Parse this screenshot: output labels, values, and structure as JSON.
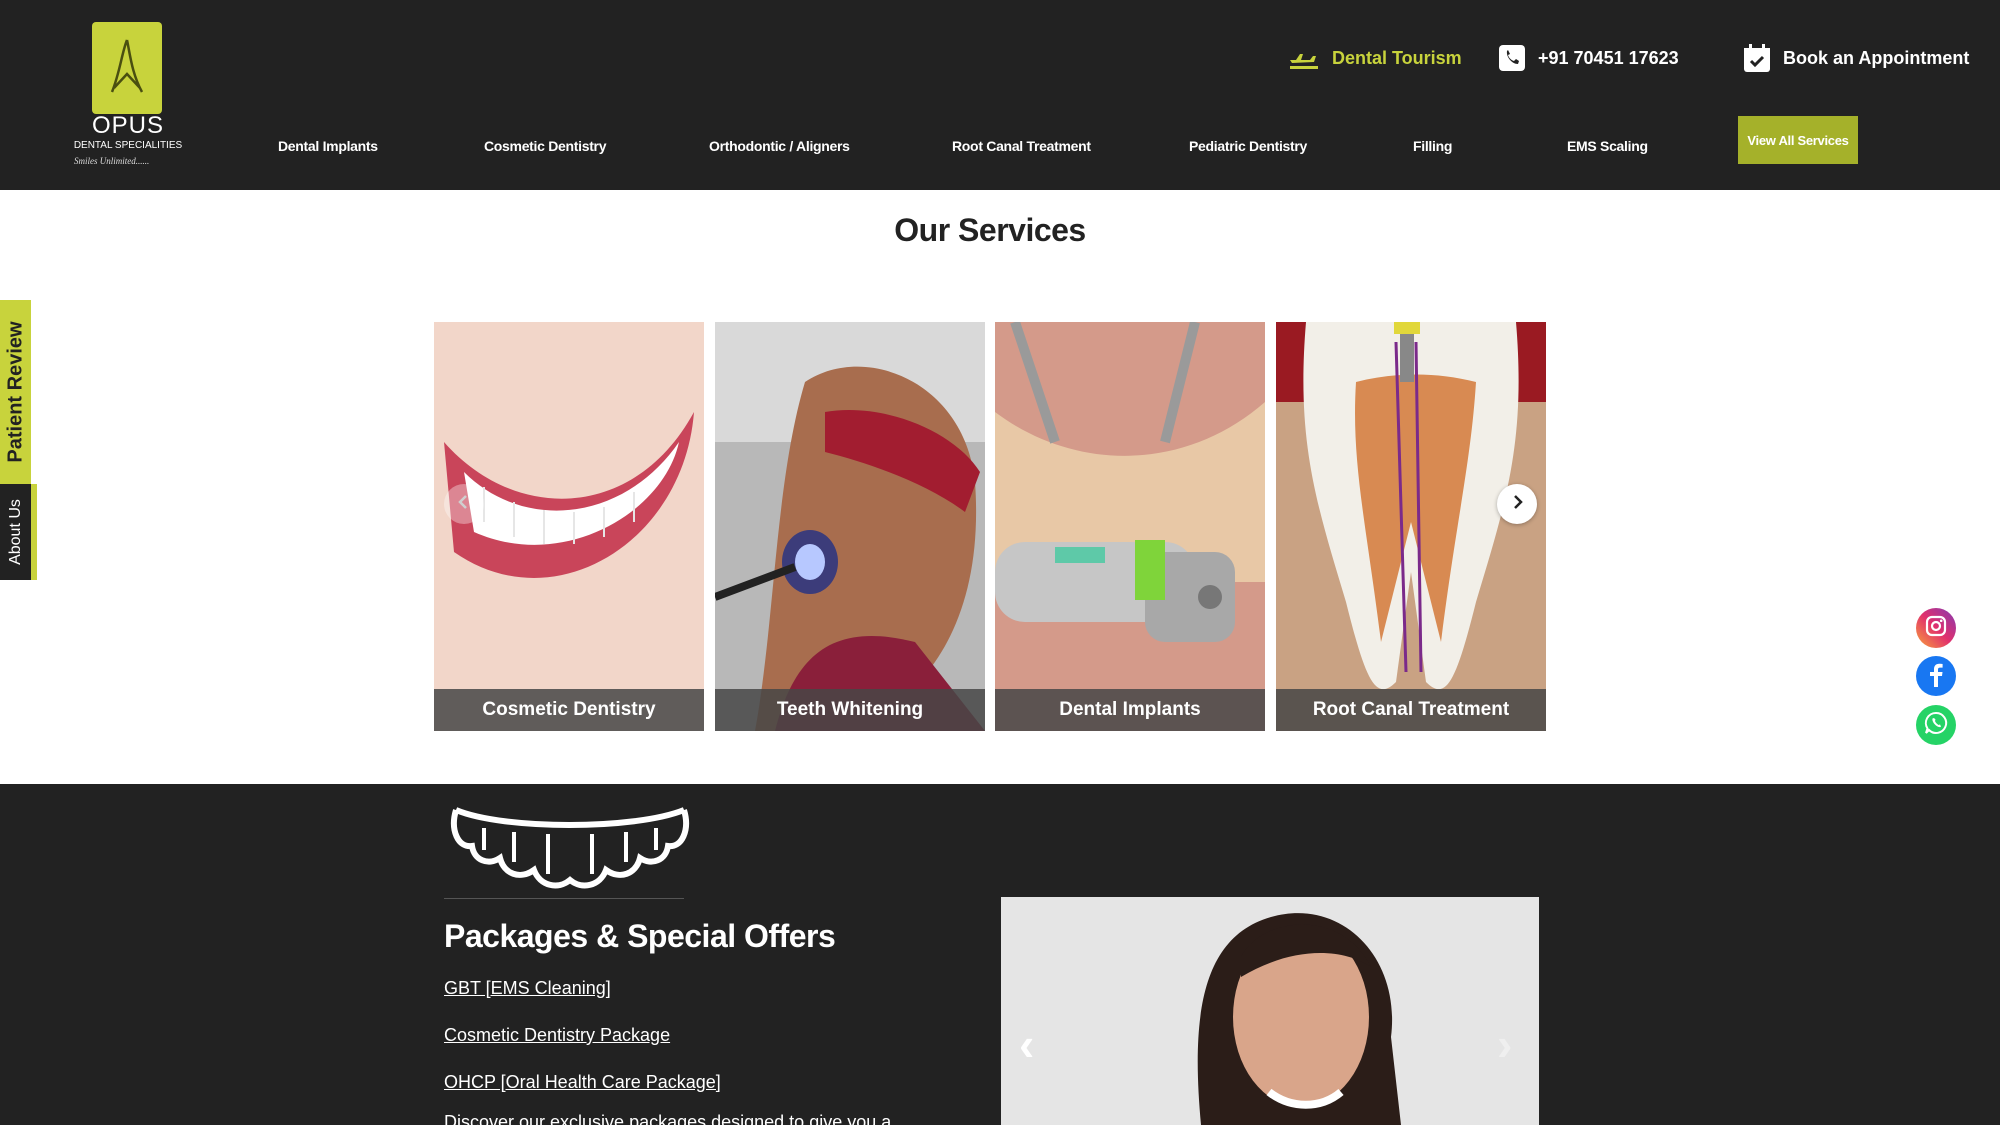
{
  "header": {
    "logo": {
      "name": "OPUS",
      "subtitle": "DENTAL SPECIALITIES",
      "tagline": "Smiles Unlimited......"
    },
    "top_links": {
      "tourism": "Dental Tourism",
      "phone": "+91 70451 17623",
      "appointment": "Book an Appointment"
    },
    "nav": [
      "Dental Implants",
      "Cosmetic Dentistry",
      "Orthodontic / Aligners",
      "Root Canal Treatment",
      "Pediatric Dentistry",
      "Filling",
      "EMS Scaling"
    ],
    "view_all": "View All Services"
  },
  "side_tabs": {
    "review": "Patient Review",
    "about": "About Us"
  },
  "services": {
    "title": "Our Services",
    "cards": [
      {
        "label": "Cosmetic Dentistry"
      },
      {
        "label": "Teeth Whitening"
      },
      {
        "label": "Dental Implants"
      },
      {
        "label": "Root Canal Treatment"
      }
    ]
  },
  "social": [
    "instagram-icon",
    "facebook-icon",
    "whatsapp-icon"
  ],
  "packages": {
    "title": "Packages & Special Offers",
    "links": [
      "GBT [EMS Cleaning]",
      "Cosmetic Dentistry Package",
      "OHCP [Oral Health Care Package]"
    ],
    "more": "Discover our exclusive packages designed to give you a perfect smile"
  },
  "colors": {
    "accent": "#c8d33c",
    "dark": "#222222",
    "button": "#a5b12a"
  }
}
